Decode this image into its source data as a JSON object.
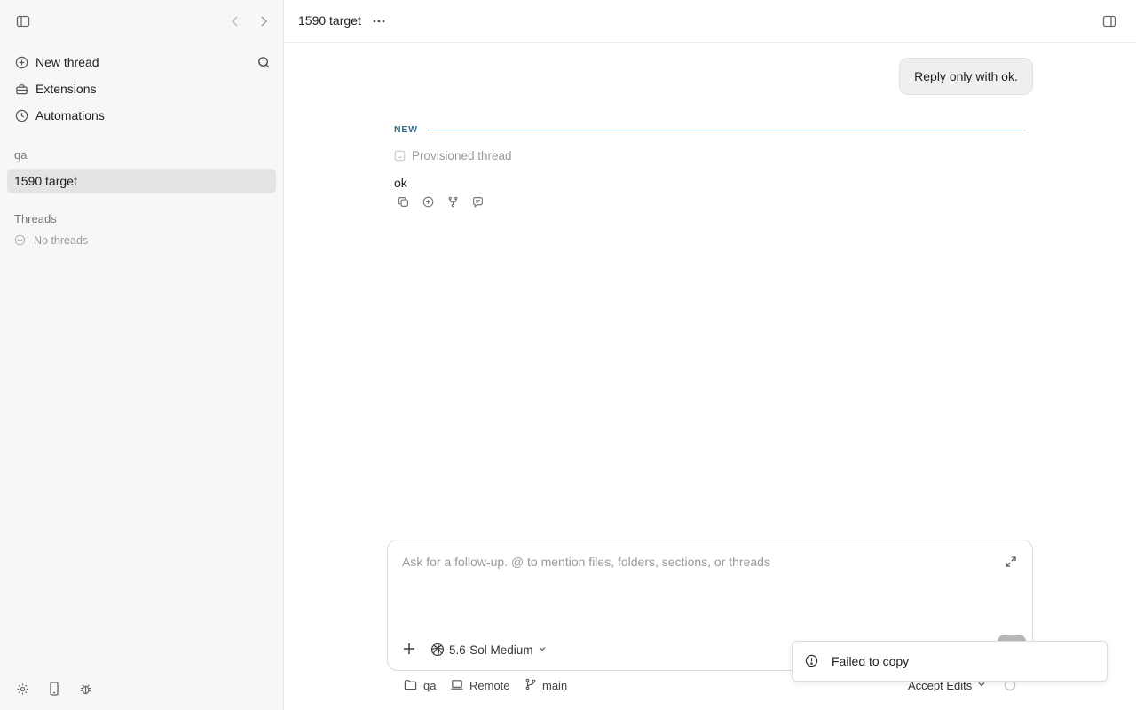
{
  "sidebar": {
    "nav": [
      {
        "label": "New thread",
        "icon": "plus-circle-icon"
      },
      {
        "label": "Extensions",
        "icon": "toolbox-icon"
      },
      {
        "label": "Automations",
        "icon": "clock-icon"
      }
    ],
    "project_label": "qa",
    "active_thread": "1590 target",
    "threads_section": "Threads",
    "no_threads": "No threads"
  },
  "header": {
    "title": "1590 target"
  },
  "conversation": {
    "user_message": "Reply only with ok.",
    "new_label": "NEW",
    "status": "Provisioned thread",
    "reply": "ok"
  },
  "composer": {
    "placeholder": "Ask for a follow-up. @ to mention files, folders, sections, or threads",
    "value": "",
    "model": "5.6-Sol Medium"
  },
  "footer": {
    "folder": "qa",
    "environment": "Remote",
    "branch": "main",
    "mode": "Accept Edits"
  },
  "toast": {
    "message": "Failed to copy"
  },
  "colors": {
    "accent": "#3a6d8c",
    "sidebar_bg": "#f7f7f7",
    "selected_bg": "#e4e4e4"
  }
}
